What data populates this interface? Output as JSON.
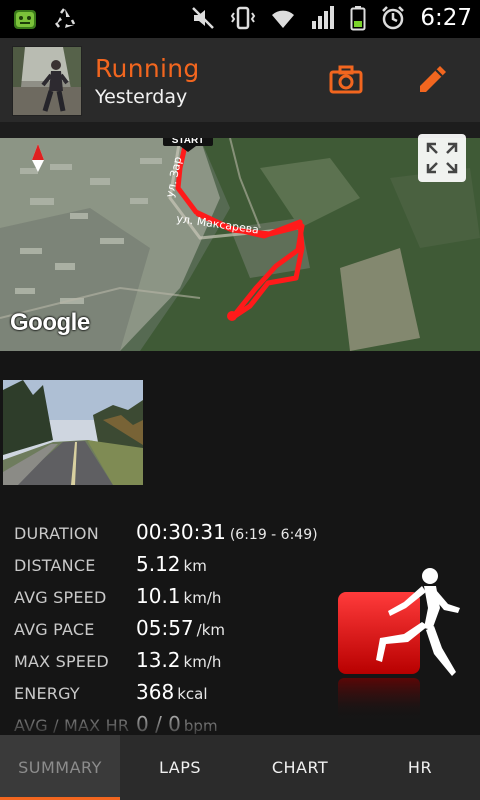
{
  "status_bar": {
    "time": "6:27",
    "icons": [
      "android-robot-icon",
      "recycle-icon",
      "mute-icon",
      "vibrate-icon",
      "wifi-icon",
      "signal-icon",
      "battery-icon",
      "alarm-icon"
    ]
  },
  "header": {
    "title": "Running",
    "subtitle": "Yesterday",
    "actions": [
      "camera-icon",
      "edit-icon"
    ]
  },
  "map": {
    "street_label": "ул. Максарева",
    "street_label_2": "ул. Зар",
    "start_marker": "START",
    "attribution": "Google"
  },
  "stats": [
    {
      "label": "DURATION",
      "value": "00:30:31",
      "unit": "",
      "extra": "(6:19 - 6:49)"
    },
    {
      "label": "DISTANCE",
      "value": "5.12",
      "unit": "km",
      "extra": ""
    },
    {
      "label": "AVG SPEED",
      "value": "10.1",
      "unit": "km/h",
      "extra": ""
    },
    {
      "label": "AVG PACE",
      "value": "05:57",
      "unit": "/km",
      "extra": ""
    },
    {
      "label": "MAX SPEED",
      "value": "13.2",
      "unit": "km/h",
      "extra": ""
    },
    {
      "label": "ENERGY",
      "value": "368",
      "unit": "kcal",
      "extra": ""
    },
    {
      "label": "AVG / MAX HR",
      "value": "0 / 0",
      "unit": "bpm",
      "extra": ""
    }
  ],
  "tabs": [
    {
      "label": "SUMMARY",
      "active": true
    },
    {
      "label": "LAPS",
      "active": false
    },
    {
      "label": "CHART",
      "active": false
    },
    {
      "label": "HR",
      "active": false
    }
  ],
  "colors": {
    "accent": "#f2661f",
    "route": "#ff1a1a",
    "sport_badge": "#e00000"
  }
}
